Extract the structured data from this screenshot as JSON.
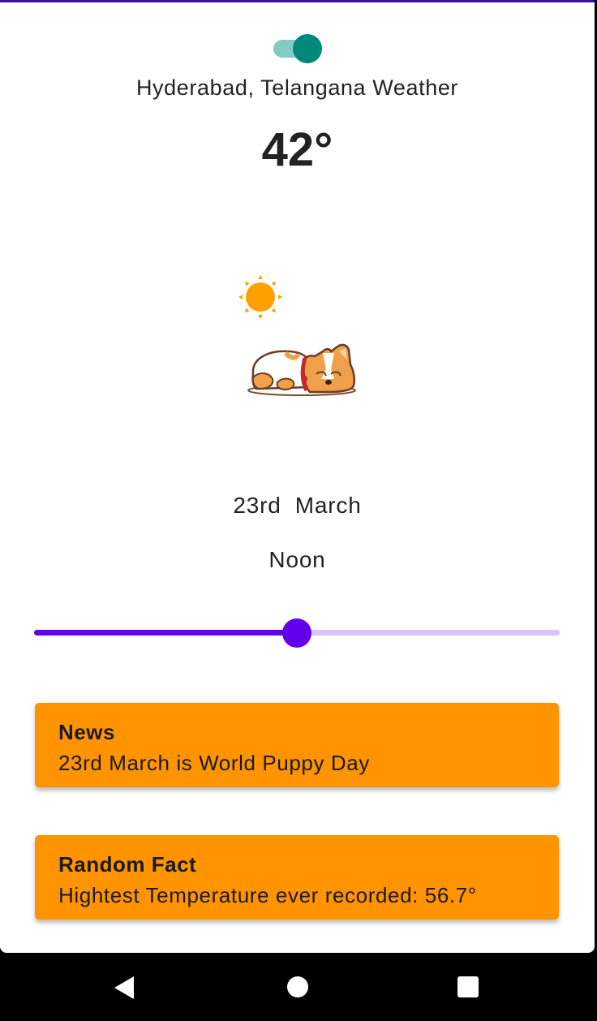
{
  "theme": {
    "accent": "#6200ee",
    "accent_light": "#d7c4ff",
    "switch_on": "#00897b",
    "card_color": "#ff9300",
    "sun_color": "#ffa000"
  },
  "header": {
    "dark_mode_switch": {
      "state": "on"
    },
    "location": "Hyderabad, Telangana Weather",
    "temperature": "42°"
  },
  "illustration": {
    "weather_icon": "sun-icon",
    "mascot": "sleeping-corgi"
  },
  "time_info": {
    "date": "23rd  March",
    "time_of_day": "Noon"
  },
  "time_slider": {
    "value_fraction": 0.5
  },
  "cards": {
    "news": {
      "title": "News",
      "body": "23rd March is World Puppy Day"
    },
    "random_fact": {
      "title": "Random Fact",
      "body": "Hightest Temperature ever recorded: 56.7°"
    }
  },
  "nav_bar": {
    "back": "back-icon",
    "home": "home-icon",
    "recents": "recents-icon"
  }
}
